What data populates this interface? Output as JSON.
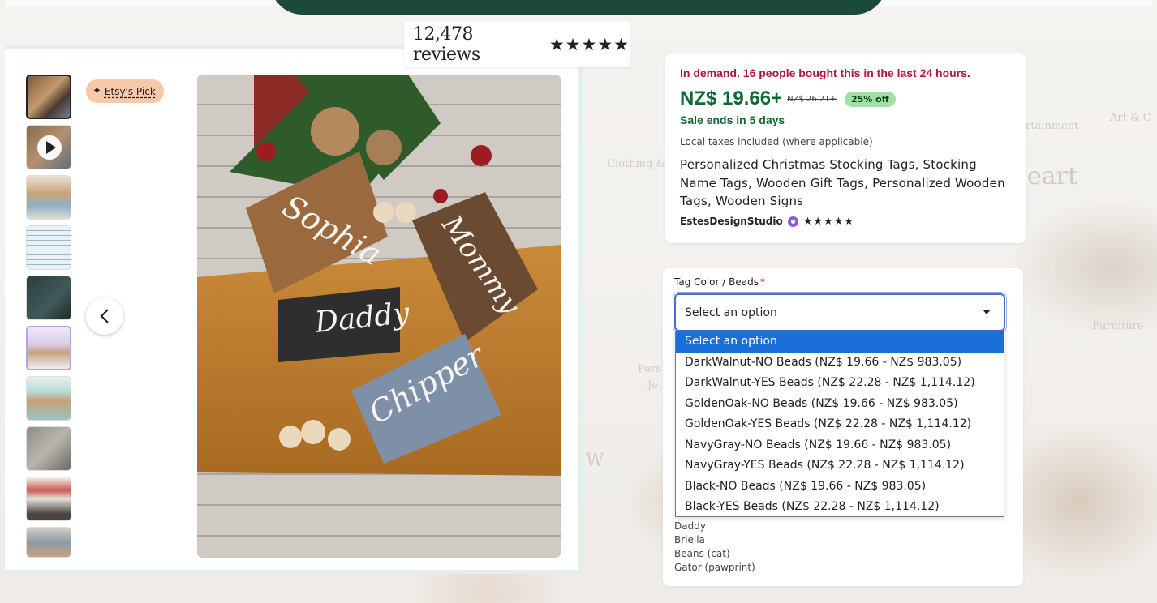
{
  "reviews": {
    "count_text": "12,478 reviews",
    "stars": "★★★★★"
  },
  "badges": {
    "etsy_pick": "Etsy's Pick",
    "etsy_pick_icon": "sparkle-icon"
  },
  "gallery": {
    "thumbnail_count": 10,
    "video_thumbnail_index": 1,
    "prev_icon": "chevron-left-icon"
  },
  "image": {
    "tags": [
      "Sophia",
      "Mommy",
      "Daddy",
      "Chipper"
    ]
  },
  "listing": {
    "demand": "In demand. 16 people bought this in the last 24 hours.",
    "price": "NZ$ 19.66+",
    "original_price": "NZ$ 26.21+",
    "discount": "25% off",
    "sale_ends": "Sale ends in 5 days",
    "taxes": "Local taxes included (where applicable)",
    "title": "Personalized Christmas Stocking Tags, Stocking Name Tags, Wooden Gift Tags, Personalized Wooden Tags, Wooden Signs",
    "shop_name": "EstesDesignStudio",
    "shop_stars": "★★★★★"
  },
  "options": {
    "label": "Tag Color / Beads",
    "required_mark": "*",
    "selected": "Select an option",
    "items": [
      "Select an option",
      "DarkWalnut-NO Beads (NZ$ 19.66 - NZ$ 983.05)",
      "DarkWalnut-YES Beads (NZ$ 22.28 - NZ$ 1,114.12)",
      "GoldenOak-NO Beads (NZ$ 19.66 - NZ$ 983.05)",
      "GoldenOak-YES Beads (NZ$ 22.28 - NZ$ 1,114.12)",
      "NavyGray-NO Beads (NZ$ 19.66 - NZ$ 983.05)",
      "NavyGray-YES Beads (NZ$ 22.28 - NZ$ 1,114.12)",
      "Black-NO Beads (NZ$ 19.66 - NZ$ 983.05)",
      "Black-YES Beads (NZ$ 22.28 - NZ$ 1,114.12)"
    ]
  },
  "personalization_examples": [
    "Daddy",
    "Briella",
    "Beans (cat)",
    "Gator (pawprint)"
  ],
  "background_words": [
    "Clothing &",
    "rtainment",
    "Art & C",
    "eart",
    "Furniture",
    "Pers",
    "Je",
    "W"
  ],
  "colors": {
    "banner": "#1c4a3a",
    "demand_red": "#b5163b",
    "price_green": "#0d6b31",
    "discount_badge": "#9fe0a5",
    "etsy_pick_bg": "#f7c9a8",
    "dropdown_highlight": "#1a6fd8"
  }
}
